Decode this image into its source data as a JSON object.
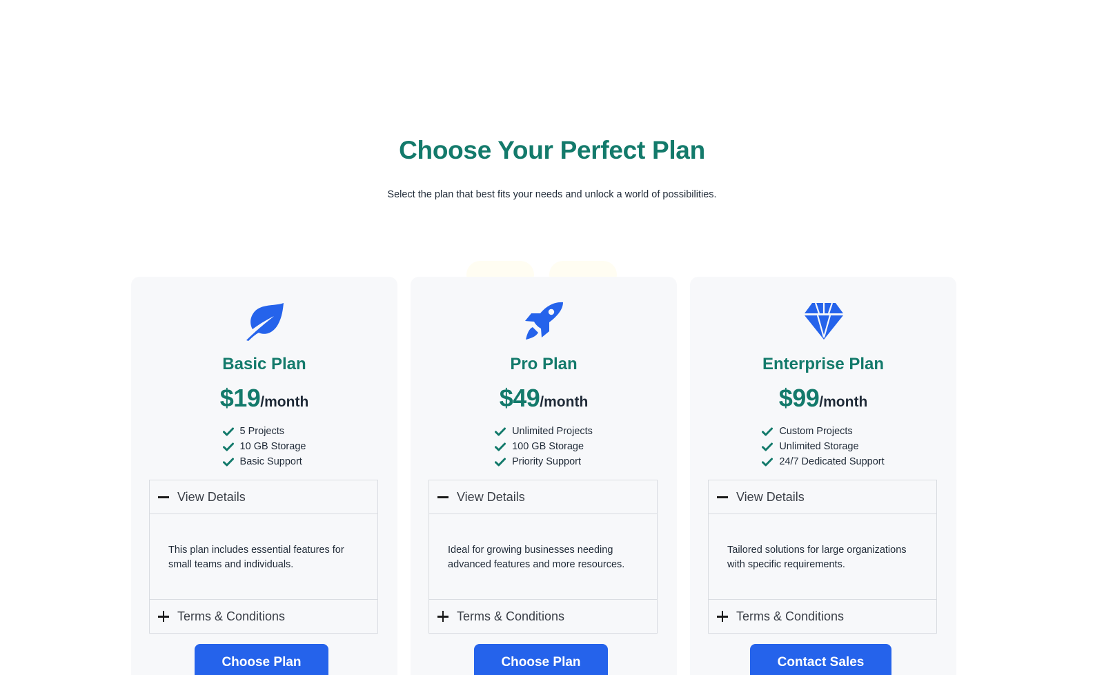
{
  "header": {
    "title": "Choose Your Perfect Plan",
    "subtitle": "Select the plan that best fits your needs and unlock a world of possibilities."
  },
  "colors": {
    "accent_teal": "#137a6b",
    "primary_blue": "#2563eb",
    "card_bg": "#f7f8fa"
  },
  "plans": [
    {
      "icon": "leaf-icon",
      "name": "Basic Plan",
      "price": "$19",
      "period": "/month",
      "features": [
        "5 Projects",
        "10 GB Storage",
        "Basic Support"
      ],
      "details_label": "View Details",
      "details_text": "This plan includes essential features for small teams and individuals.",
      "terms_label": "Terms & Conditions",
      "cta": "Choose Plan"
    },
    {
      "icon": "rocket-icon",
      "name": "Pro Plan",
      "price": "$49",
      "period": "/month",
      "features": [
        "Unlimited Projects",
        "100 GB Storage",
        "Priority Support"
      ],
      "details_label": "View Details",
      "details_text": "Ideal for growing businesses needing advanced features and more resources.",
      "terms_label": "Terms & Conditions",
      "cta": "Choose Plan"
    },
    {
      "icon": "diamond-icon",
      "name": "Enterprise Plan",
      "price": "$99",
      "period": "/month",
      "features": [
        "Custom Projects",
        "Unlimited Storage",
        "24/7 Dedicated Support"
      ],
      "details_label": "View Details",
      "details_text": "Tailored solutions for large organizations with specific requirements.",
      "terms_label": "Terms & Conditions",
      "cta": "Contact Sales"
    }
  ]
}
